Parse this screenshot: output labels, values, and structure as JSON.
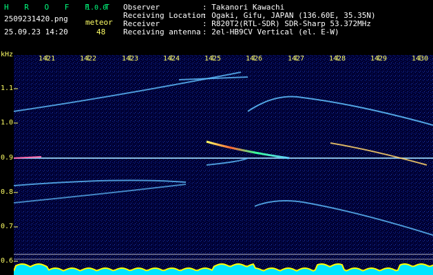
{
  "header": {
    "brand": "H R O F F T",
    "version": "1.0.0",
    "filename": "2509231420.png",
    "datetime": "25.09.23 14:20",
    "meteor_label": "meteor",
    "meteor_count": "48",
    "info": [
      {
        "label": "Observer",
        "value": ": Takanori Kawachi"
      },
      {
        "label": "Receiving Location",
        "value": ": Ogaki, Gifu, JAPAN (136.60E, 35.35N)"
      },
      {
        "label": "Receiver",
        "value": ": R820T2(RTL-SDR) SDR-Sharp 53.372MHz"
      },
      {
        "label": "Receiving antenna",
        "value": ": 2el-HB9CV Vertical (el. E-W)"
      }
    ]
  },
  "axis": {
    "unit": "kHz",
    "x_ticks": [
      "1421",
      "1422",
      "1423",
      "1424",
      "1425",
      "1426",
      "1427",
      "1428",
      "1429",
      "1430"
    ],
    "y_ticks": [
      "1.1",
      "1.0",
      "0.9",
      "0.8",
      "0.7",
      "0.6"
    ]
  },
  "colors": {
    "background": "#000033",
    "trace": "#7fd7ff",
    "carrier": "#ffffff",
    "baseline": "#ffff00",
    "baseline_fill": "#00e5ff"
  }
}
